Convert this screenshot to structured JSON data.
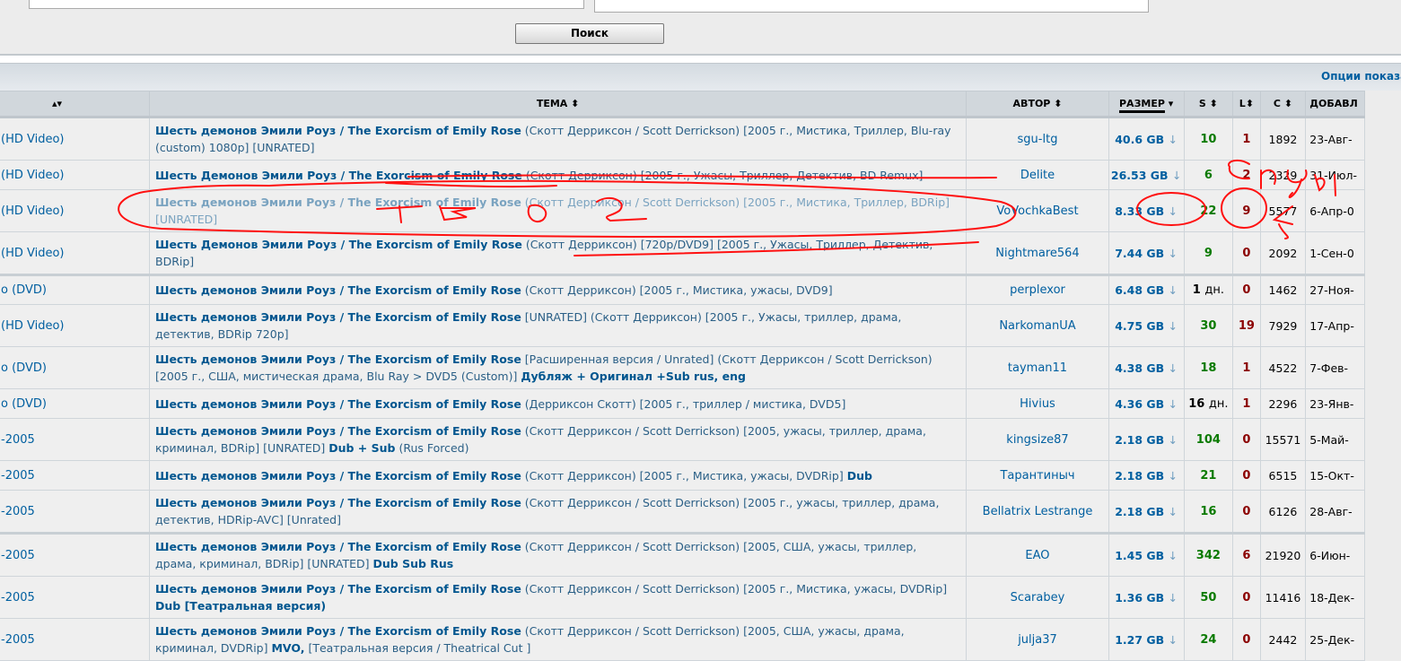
{
  "search": {
    "button": "Поиск"
  },
  "options_link": "Опции показа",
  "columns": {
    "topic": "ТЕМА",
    "author": "АВТОР",
    "size": "РАЗМЕР",
    "seeds": "S",
    "leech": "L",
    "completed": "C",
    "added": "ДОБАВЛ"
  },
  "sort_icons": {
    "topic": "sort-updown-icon",
    "size": "sort-down-icon"
  },
  "colors": {
    "link": "#005fa0",
    "seeds": "#0a7a00",
    "leech": "#8b0000",
    "annotation": "#ff0000"
  },
  "rows": [
    {
      "cat": "(HD Video)",
      "title": [
        [
          "Шесть демонов Эмили Роуз / The Exorcism of Emily Rose",
          1
        ],
        [
          " (Скотт Дерриксон / Scott Derrickson) [2005 г., Мистика, Триллер, Blu-ray (custom) 1080p] [UNRATED]",
          0
        ]
      ],
      "author": "sgu-ltg",
      "size": "40.6 GB",
      "s": "10",
      "l": "1",
      "c": "1892",
      "d": "23-Авг-"
    },
    {
      "cat": "(HD Video)",
      "title": [
        [
          "Шесть Демонов Эмили Роуз / The Exorcism of Emily Rose",
          1
        ],
        [
          " (Скотт Дерриксон) [2005 г., Ужасы, Триллер, Детектив, BD Remux]",
          0
        ]
      ],
      "author": "Delite",
      "size": "26.53 GB",
      "s": "6",
      "l": "2",
      "c": "2329",
      "d": "31-Июл-"
    },
    {
      "cat": "(HD Video)",
      "faded": true,
      "title": [
        [
          "Шесть демонов Эмили Роуз / The Exorcism of Emily Rose",
          1
        ],
        [
          " (Скотт Дерриксон / Scott Derrickson) [2005 г., Мистика, Триллер, BDRip] [UNRATED]",
          0
        ]
      ],
      "author": "VoVochkaBest",
      "size": "8.33 GB",
      "s": "22",
      "l": "9",
      "c": "5577",
      "d": "6-Апр-0"
    },
    {
      "cat": "(HD Video)",
      "sep": true,
      "title": [
        [
          "Шесть Демонов Эмили Роуз / The Exorcism of Emily Rose",
          1
        ],
        [
          " (Скотт Дерриксон) [720p/DVD9] [2005 г., Ужасы, Триллер, Детектив, BDRip]",
          0
        ]
      ],
      "author": "Nightmare564",
      "size": "7.44 GB",
      "s": "9",
      "l": "0",
      "c": "2092",
      "d": "1-Сен-0"
    },
    {
      "cat": "o (DVD)",
      "title": [
        [
          "Шесть демонов Эмили Роуз / The Exorcism of Emily Rose",
          1
        ],
        [
          " (Скотт Дерриксон) [2005 г., Мистика, ужасы, DVD9]",
          0
        ]
      ],
      "author": "perplexor",
      "size": "6.48 GB",
      "s": "1",
      "s_unit": "дн.",
      "l": "0",
      "c": "1462",
      "d": "27-Ноя-"
    },
    {
      "cat": "(HD Video)",
      "title": [
        [
          "Шесть демонов Эмили Роуз / The Exorcism of Emily Rose",
          1
        ],
        [
          " [UNRATED] (Скотт Дерриксон) [2005 г., Ужасы, триллер, драма, детектив, BDRip 720p]",
          0
        ]
      ],
      "author": "NarkomanUA",
      "size": "4.75 GB",
      "s": "30",
      "l": "19",
      "c": "7929",
      "d": "17-Апр-"
    },
    {
      "cat": "o (DVD)",
      "title": [
        [
          "Шесть демонов Эмили Роуз / The Exorcism of Emily Rose",
          1
        ],
        [
          " [Расширенная версия / Unrated] (Скотт Дерриксон / Scott Derrickson) [2005 г., США, мистическая драма, Blu Ray > DVD5 (Custom)] ",
          0
        ],
        [
          "Дубляж + Оригинал +Sub rus, eng",
          1
        ]
      ],
      "author": "tayman11",
      "size": "4.38 GB",
      "s": "18",
      "l": "1",
      "c": "4522",
      "d": "7-Фев-"
    },
    {
      "cat": "o (DVD)",
      "title": [
        [
          "Шесть демонов Эмили Роуз / The Exorcism of Emily Rose",
          1
        ],
        [
          " (Дерриксон Скотт) [2005 г., триллер / мистика, DVD5]",
          0
        ]
      ],
      "author": "Hivius",
      "size": "4.36 GB",
      "s": "16",
      "s_unit": "дн.",
      "l": "1",
      "c": "2296",
      "d": "23-Янв-"
    },
    {
      "cat": "-2005",
      "title": [
        [
          "Шесть демонов Эмили Роуз / The Exorcism of Emily Rose",
          1
        ],
        [
          " (Скотт Дерриксон / Scott Derrickson) [2005, ужасы, триллер, драма, криминал, BDRip] [UNRATED] ",
          0
        ],
        [
          "Dub + Sub",
          1
        ],
        [
          " (Rus Forced)",
          0
        ]
      ],
      "author": "kingsize87",
      "size": "2.18 GB",
      "s": "104",
      "l": "0",
      "c": "15571",
      "d": "5-Май-"
    },
    {
      "cat": "-2005",
      "title": [
        [
          "Шесть демонов Эмили Роуз / The Exorcism of Emily Rose",
          1
        ],
        [
          " (Скотт Дерриксон) [2005 г., Мистика, ужасы, DVDRip] ",
          0
        ],
        [
          "Dub",
          1
        ]
      ],
      "author": "Тарантиныч",
      "size": "2.18 GB",
      "s": "21",
      "l": "0",
      "c": "6515",
      "d": "15-Окт-"
    },
    {
      "cat": "-2005",
      "sep": true,
      "title": [
        [
          "Шесть демонов Эмили Роуз / The Exorcism of Emily Rose",
          1
        ],
        [
          " (Скотт Дерриксон / Scott Derrickson) [2005 г., ужасы, триллер, драма, детектив, HDRip-AVC] [Unrated]",
          0
        ]
      ],
      "author": "Bellatrix Lestrange",
      "size": "2.18 GB",
      "s": "16",
      "l": "0",
      "c": "6126",
      "d": "28-Авг-"
    },
    {
      "cat": "-2005",
      "title": [
        [
          "Шесть демонов Эмили Роуз / The Exorcism of Emily Rose",
          1
        ],
        [
          " (Скотт Дерриксон / Scott Derrickson) [2005, США, ужасы, триллер, драма, криминал, BDRip] [UNRATED] ",
          0
        ],
        [
          "Dub Sub Rus",
          1
        ]
      ],
      "author": "EAO",
      "size": "1.45 GB",
      "s": "342",
      "l": "6",
      "c": "21920",
      "d": "6-Июн-"
    },
    {
      "cat": "-2005",
      "title": [
        [
          "Шесть демонов Эмили Роуз / The Exorcism of Emily Rose",
          1
        ],
        [
          " (Скотт Дерриксон / Scott Derrickson) [2005 г., Мистика, ужасы, DVDRip] ",
          0
        ],
        [
          "Dub [Театральная версия)",
          1
        ]
      ],
      "author": "Scarabey",
      "size": "1.36 GB",
      "s": "50",
      "l": "0",
      "c": "11416",
      "d": "18-Дек-"
    },
    {
      "cat": "-2005",
      "title": [
        [
          "Шесть демонов Эмили Роуз / The Exorcism of Emily Rose",
          1
        ],
        [
          " (Скотт Дерриксон / Scott Derrickson) [2005, США, ужасы, драма, криминал, DVDRip] ",
          0
        ],
        [
          "MVO,",
          1
        ],
        [
          " [Театральная версия / Theatrical Cut ]",
          0
        ]
      ],
      "author": "julja37",
      "size": "1.27 GB",
      "s": "24",
      "l": "0",
      "c": "2442",
      "d": "25-Дек-"
    }
  ]
}
